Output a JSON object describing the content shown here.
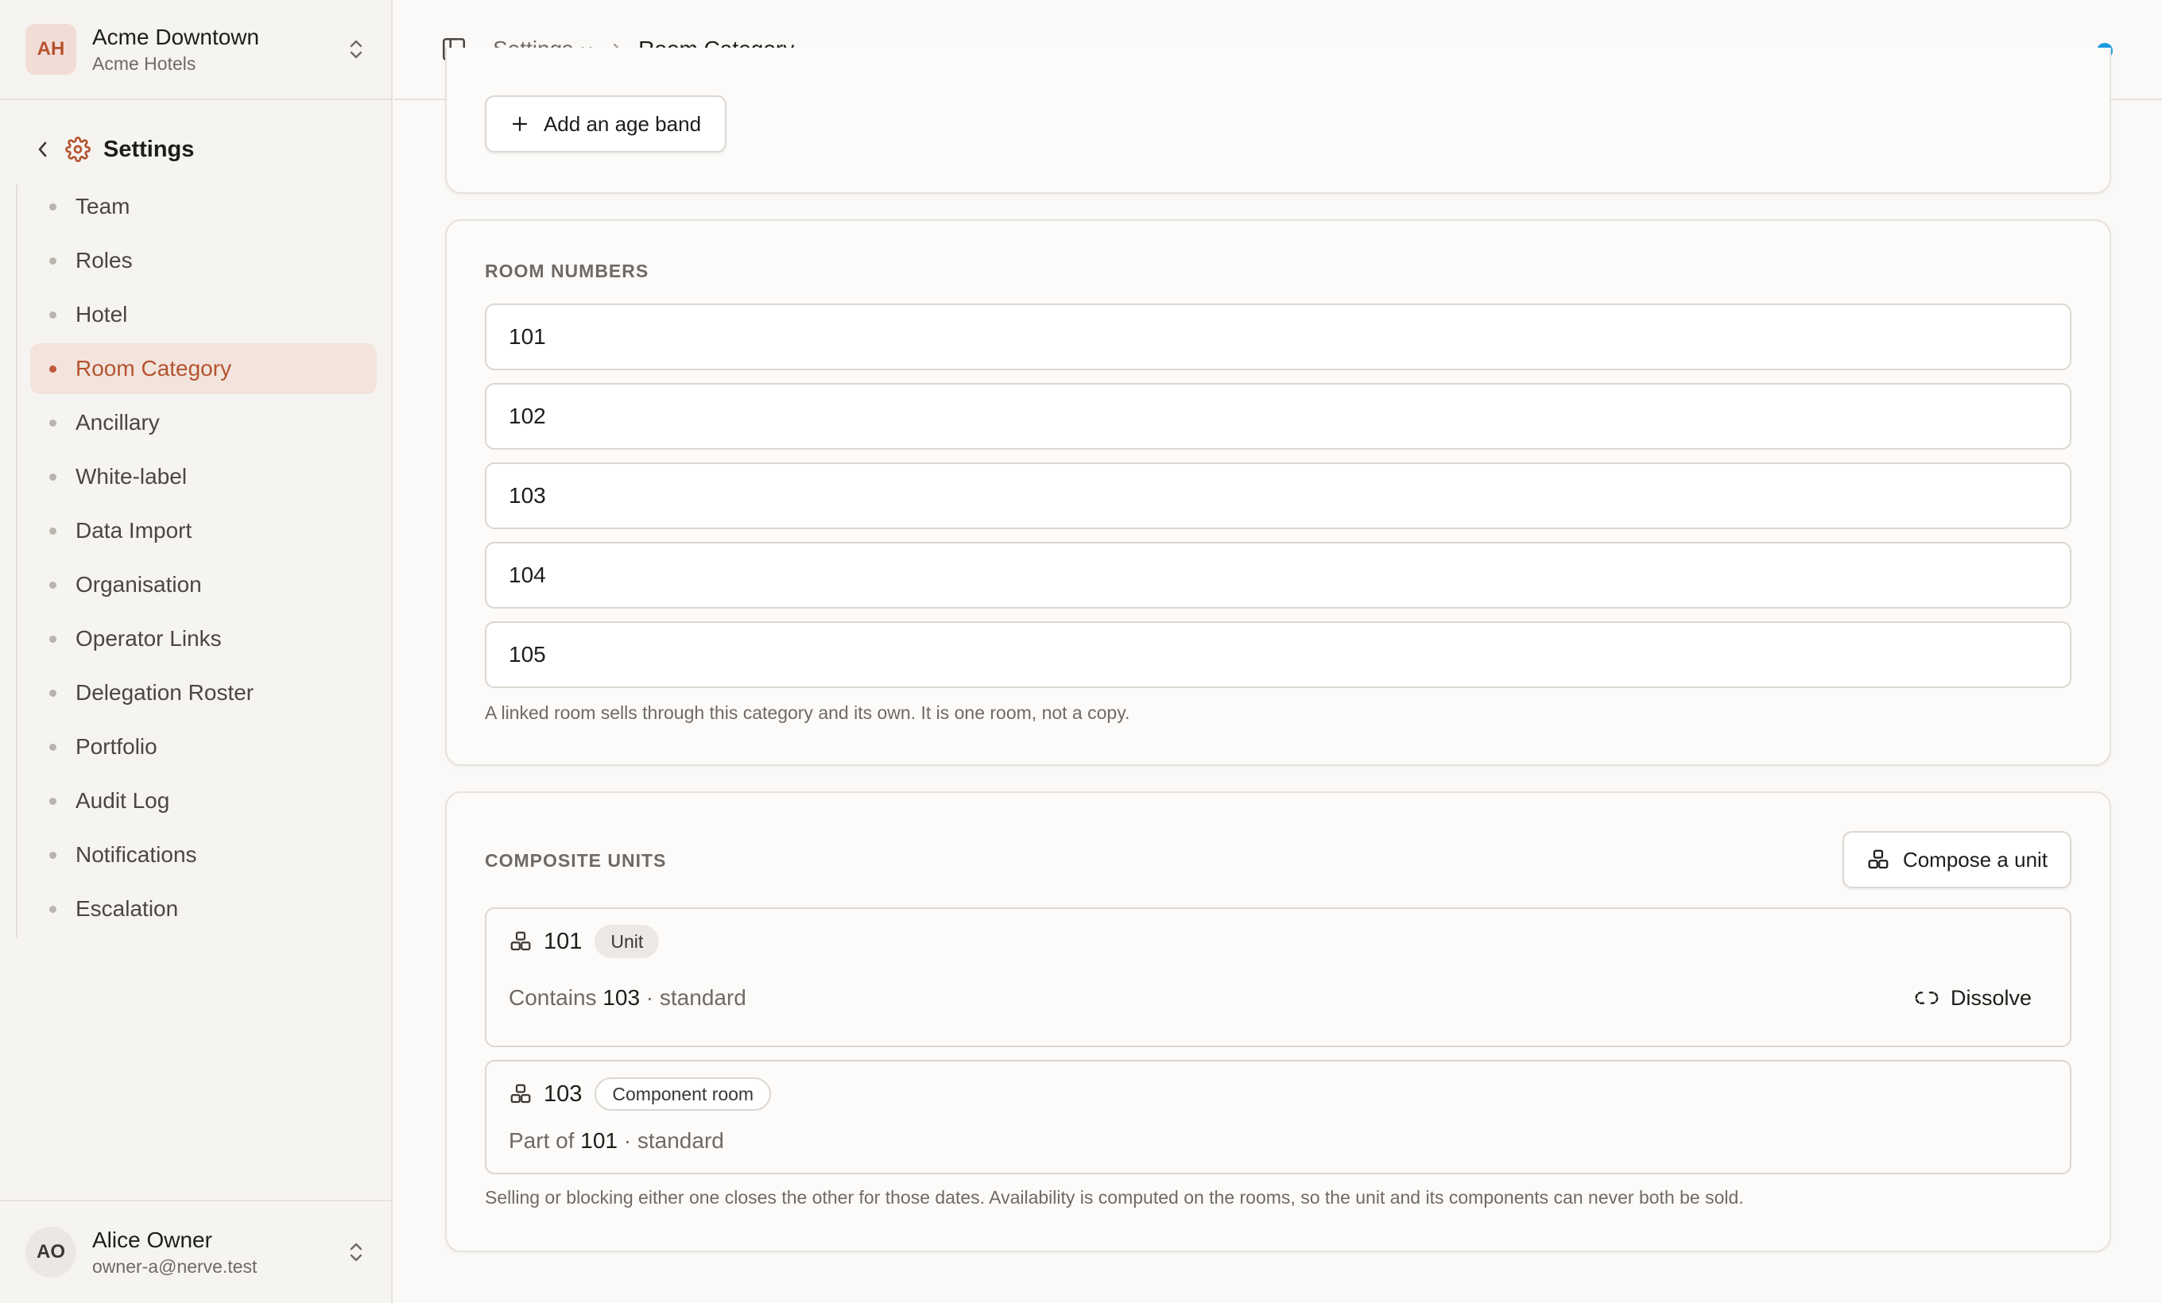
{
  "org": {
    "initials": "AH",
    "name": "Acme Downtown",
    "group": "Acme Hotels"
  },
  "sidebar": {
    "back_title": "Settings",
    "items": [
      {
        "label": "Team"
      },
      {
        "label": "Roles"
      },
      {
        "label": "Hotel"
      },
      {
        "label": "Room Category",
        "active": true
      },
      {
        "label": "Ancillary"
      },
      {
        "label": "White-label"
      },
      {
        "label": "Data Import"
      },
      {
        "label": "Organisation"
      },
      {
        "label": "Operator Links"
      },
      {
        "label": "Delegation Roster"
      },
      {
        "label": "Portfolio"
      },
      {
        "label": "Audit Log"
      },
      {
        "label": "Notifications"
      },
      {
        "label": "Escalation"
      }
    ]
  },
  "user": {
    "initials": "AO",
    "name": "Alice Owner",
    "email": "owner-a@nerve.test"
  },
  "breadcrumb": {
    "parent": "Settings",
    "current": "Room Category"
  },
  "age_bands": {
    "add_label": "Add an age band"
  },
  "room_numbers": {
    "title": "ROOM NUMBERS",
    "rooms": [
      "101",
      "102",
      "103",
      "104",
      "105"
    ],
    "hint": "A linked room sells through this category and its own. It is one room, not a copy."
  },
  "composite_units": {
    "title": "COMPOSITE UNITS",
    "compose_label": "Compose a unit",
    "units": [
      {
        "number": "101",
        "tag": "Unit",
        "desc_prefix": "Contains",
        "ref": "103",
        "desc_suffix": "· standard",
        "action": "Dissolve"
      },
      {
        "number": "103",
        "tag": "Component room",
        "desc_prefix": "Part of",
        "ref": "101",
        "desc_suffix": "· standard"
      }
    ],
    "hint": "Selling or blocking either one closes the other for those dates. Availability is computed on the rooms, so the unit and its components can never both be sold."
  },
  "colors": {
    "accent": "#b5532f",
    "status": "#1a9be0"
  }
}
